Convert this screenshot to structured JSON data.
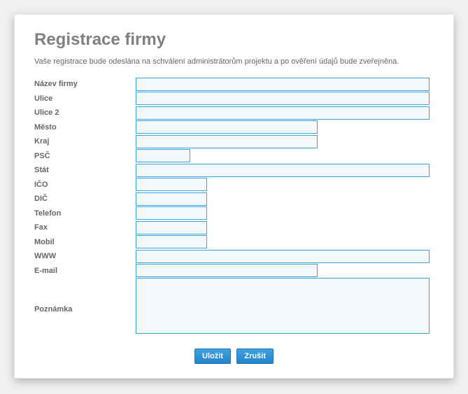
{
  "page": {
    "title": "Registrace firmy",
    "intro": "Vaše registrace bude odeslána na schválení administrátorům projektu a po ověření údajů bude zveřejněna."
  },
  "form": {
    "nazev_firmy": {
      "label": "Název firmy",
      "value": ""
    },
    "ulice": {
      "label": "Ulice",
      "value": ""
    },
    "ulice2": {
      "label": "Ulice 2",
      "value": ""
    },
    "mesto": {
      "label": "Město",
      "value": ""
    },
    "kraj": {
      "label": "Kraj",
      "value": ""
    },
    "psc": {
      "label": "PSČ",
      "value": ""
    },
    "stat": {
      "label": "Stát",
      "value": ""
    },
    "ico": {
      "label": "IČO",
      "value": ""
    },
    "dic": {
      "label": "DIČ",
      "value": ""
    },
    "telefon": {
      "label": "Telefon",
      "value": ""
    },
    "fax": {
      "label": "Fax",
      "value": ""
    },
    "mobil": {
      "label": "Mobil",
      "value": ""
    },
    "www": {
      "label": "WWW",
      "value": ""
    },
    "email": {
      "label": "E-mail",
      "value": ""
    },
    "poznamka": {
      "label": "Poznámka",
      "value": ""
    }
  },
  "buttons": {
    "save": "Uložit",
    "cancel": "Zrušit"
  }
}
